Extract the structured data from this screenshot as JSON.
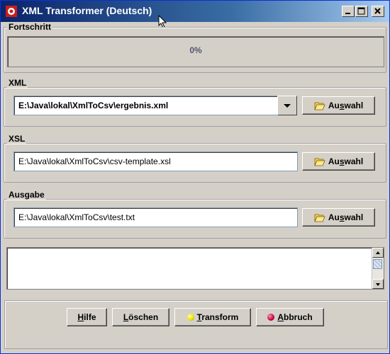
{
  "window": {
    "title": "XML Transformer (Deutsch)",
    "controls": {
      "minimize": "minimize-icon",
      "maximize": "maximize-icon",
      "close": "close-icon"
    }
  },
  "progress": {
    "label": "Fortschritt",
    "value_text": "0%",
    "value": 0
  },
  "xml": {
    "label": "XML",
    "value": "E:\\Java\\lokal\\XmlToCsv\\ergebnis.xml",
    "button_prefix": "Au",
    "button_underline": "s",
    "button_suffix": "wahl"
  },
  "xsl": {
    "label": "XSL",
    "value": "E:\\Java\\lokal\\XmlToCsv\\csv-template.xsl",
    "button_prefix": "Au",
    "button_underline": "s",
    "button_suffix": "wahl"
  },
  "output": {
    "label": "Ausgabe",
    "value": "E:\\Java\\lokal\\XmlToCsv\\test.txt",
    "button_prefix": "Au",
    "button_underline": "s",
    "button_suffix": "wahl"
  },
  "log": {
    "text": ""
  },
  "buttons": {
    "help": {
      "underline": "H",
      "rest": "ilfe"
    },
    "clear": {
      "underline": "L",
      "rest": "öschen"
    },
    "transform": {
      "underline": "T",
      "rest": "ransform"
    },
    "abort": {
      "underline": "A",
      "rest": "bbruch"
    }
  },
  "colors": {
    "titlebar_start": "#0a246a",
    "titlebar_end": "#a6caf0",
    "progress_text": "#545470",
    "transform_dot": "#e8e000",
    "abort_dot": "#c8003c"
  }
}
